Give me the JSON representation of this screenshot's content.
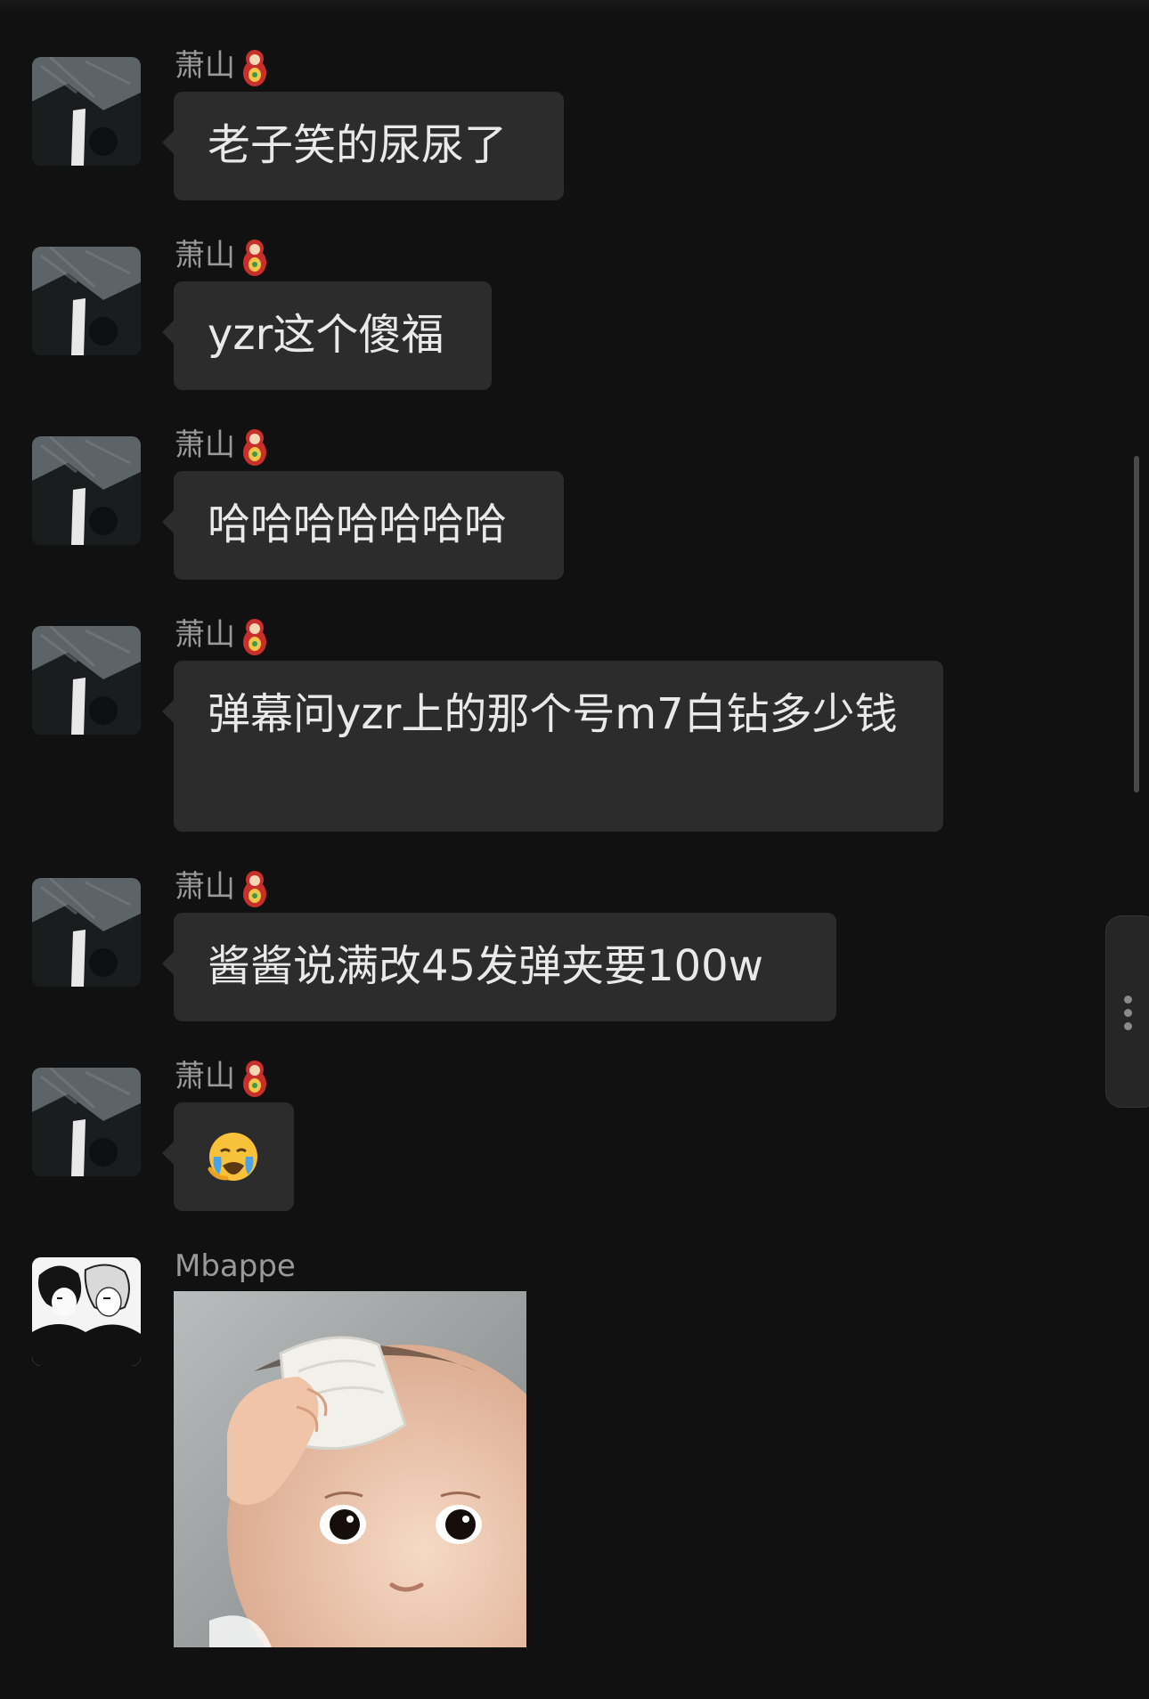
{
  "chat": {
    "messages": [
      {
        "sender": "萧山",
        "sender_badge": "matryoshka-doll-icon",
        "type": "text",
        "text": "老子笑的尿尿了"
      },
      {
        "sender": "萧山",
        "sender_badge": "matryoshka-doll-icon",
        "type": "text",
        "text": "yzr这个傻福"
      },
      {
        "sender": "萧山",
        "sender_badge": "matryoshka-doll-icon",
        "type": "text",
        "text": "哈哈哈哈哈哈哈"
      },
      {
        "sender": "萧山",
        "sender_badge": "matryoshka-doll-icon",
        "type": "text",
        "text": "弹幕问yzr上的那个号m7白钻多少钱"
      },
      {
        "sender": "萧山",
        "sender_badge": "matryoshka-doll-icon",
        "type": "text",
        "text": "酱酱说满改45发弹夹要100w"
      },
      {
        "sender": "萧山",
        "sender_badge": "matryoshka-doll-icon",
        "type": "emoji",
        "text": "😭"
      },
      {
        "sender": "Mbappe",
        "type": "image",
        "image_desc": "baby-with-towel-sticker"
      }
    ]
  },
  "colors": {
    "background": "#111111",
    "bubble": "#2c2c2c",
    "text": "#e9e9e9",
    "sender_name": "#9a9a9a"
  }
}
